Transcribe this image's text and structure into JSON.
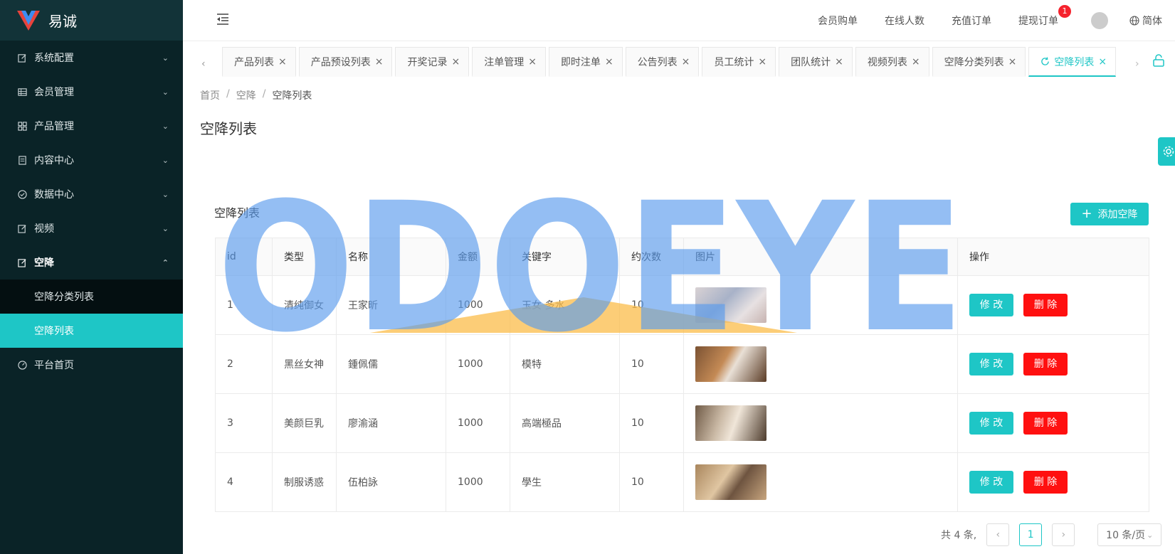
{
  "app": {
    "name": "易诚"
  },
  "sidebar": {
    "items": [
      {
        "label": "系统配置",
        "icon": "edit-icon"
      },
      {
        "label": "会员管理",
        "icon": "table-icon"
      },
      {
        "label": "产品管理",
        "icon": "grid-icon"
      },
      {
        "label": "内容中心",
        "icon": "document-icon"
      },
      {
        "label": "数据中心",
        "icon": "check-circle-icon"
      },
      {
        "label": "视频",
        "icon": "edit-icon"
      },
      {
        "label": "空降",
        "icon": "edit-icon",
        "open": true
      }
    ],
    "submenu": [
      {
        "label": "空降分类列表",
        "active": false
      },
      {
        "label": "空降列表",
        "active": true
      }
    ],
    "home": {
      "label": "平台首页",
      "icon": "dashboard-icon"
    }
  },
  "header": {
    "links": [
      "会员购单",
      "在线人数",
      "充值订单",
      "提现订单"
    ],
    "badge": "1",
    "lang": "简体"
  },
  "tabs": [
    {
      "label": "产品列表"
    },
    {
      "label": "产品预设列表"
    },
    {
      "label": "开奖记录"
    },
    {
      "label": "注单管理"
    },
    {
      "label": "即时注单"
    },
    {
      "label": "公告列表"
    },
    {
      "label": "员工统计"
    },
    {
      "label": "团队统计"
    },
    {
      "label": "视频列表"
    },
    {
      "label": "空降分类列表"
    },
    {
      "label": "空降列表",
      "active": true
    }
  ],
  "breadcrumb": [
    "首页",
    "空降",
    "空降列表"
  ],
  "page_title": "空降列表",
  "card": {
    "title": "空降列表",
    "add_button": "添加空降"
  },
  "table": {
    "columns": [
      "id",
      "类型",
      "名称",
      "金额",
      "关键字",
      "约次数",
      "图片",
      "操作"
    ],
    "rows": [
      {
        "id": "1",
        "type": "清纯御女",
        "name": "王家昕",
        "amount": "1000",
        "keywords": "玉女 多水",
        "count": "10"
      },
      {
        "id": "2",
        "type": "黑丝女神",
        "name": "鍾佩儒",
        "amount": "1000",
        "keywords": "模特",
        "count": "10"
      },
      {
        "id": "3",
        "type": "美颜巨乳",
        "name": "廖渝涵",
        "amount": "1000",
        "keywords": "高端極品",
        "count": "10"
      },
      {
        "id": "4",
        "type": "制服诱惑",
        "name": "伍柏詠",
        "amount": "1000",
        "keywords": "學生",
        "count": "10"
      }
    ],
    "edit_label": "修 改",
    "delete_label": "删 除"
  },
  "pagination": {
    "total": "共 4 条,",
    "current": "1",
    "page_size": "10 条/页"
  },
  "watermark": {
    "text": "ODOEYE"
  },
  "colors": {
    "accent": "#1ec6c6",
    "danger": "#ff1010",
    "sidebar": "#0a2327"
  }
}
